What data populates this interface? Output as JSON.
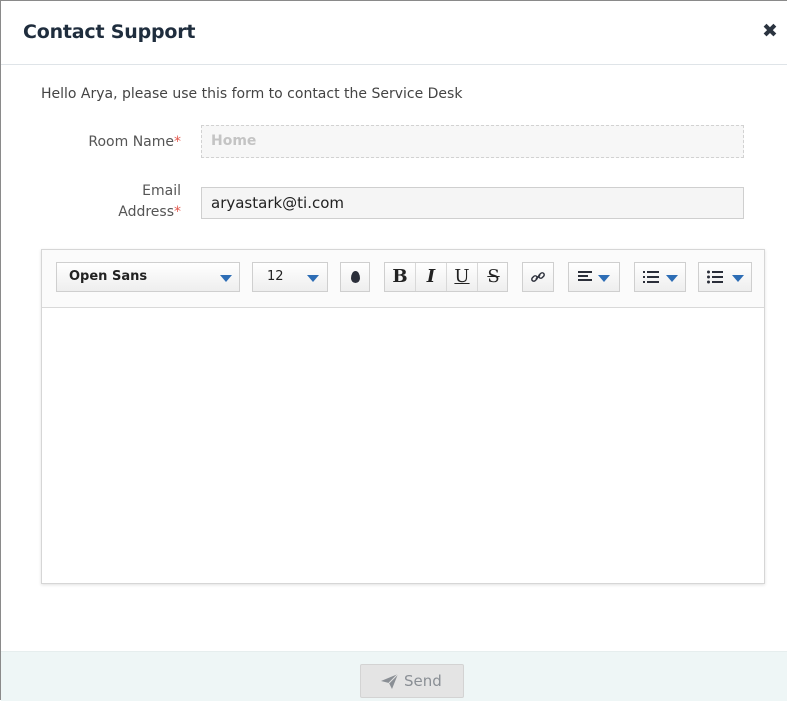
{
  "dialog": {
    "title": "Contact Support",
    "close_icon": "close-icon",
    "intro": "Hello Arya, please use this form to contact the Service Desk"
  },
  "form": {
    "room_label": "Room Name",
    "room_required": "*",
    "room_value": "Home",
    "email_label_line1": "Email",
    "email_label_line2": "Address",
    "email_required": "*",
    "email_value": "aryastark@ti.com"
  },
  "toolbar": {
    "font_family": "Open Sans",
    "font_size": "12",
    "bold": "B",
    "italic": "I",
    "underline": "U",
    "strike": "S",
    "icons": [
      "text-color-icon",
      "link-icon",
      "align-icon",
      "ordered-list-icon",
      "bullet-list-icon"
    ]
  },
  "footer": {
    "send_label": "Send",
    "send_icon": "paper-plane-icon"
  },
  "colors": {
    "required": "#e2574c",
    "caret": "#2d6db5",
    "footer_bg": "#eef6f6"
  }
}
